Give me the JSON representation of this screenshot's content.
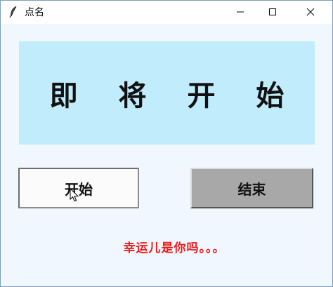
{
  "window": {
    "title": "点名",
    "icon": "feather-icon",
    "controls": [
      "minimize-icon",
      "maximize-icon",
      "close-icon"
    ]
  },
  "banner": {
    "text": "即 将 开 始",
    "background": "#c0ecfc"
  },
  "buttons": {
    "start_label": "开始",
    "end_label": "结束"
  },
  "message": {
    "text": "幸运儿是你吗。。。",
    "color": "#ee1c1c"
  }
}
